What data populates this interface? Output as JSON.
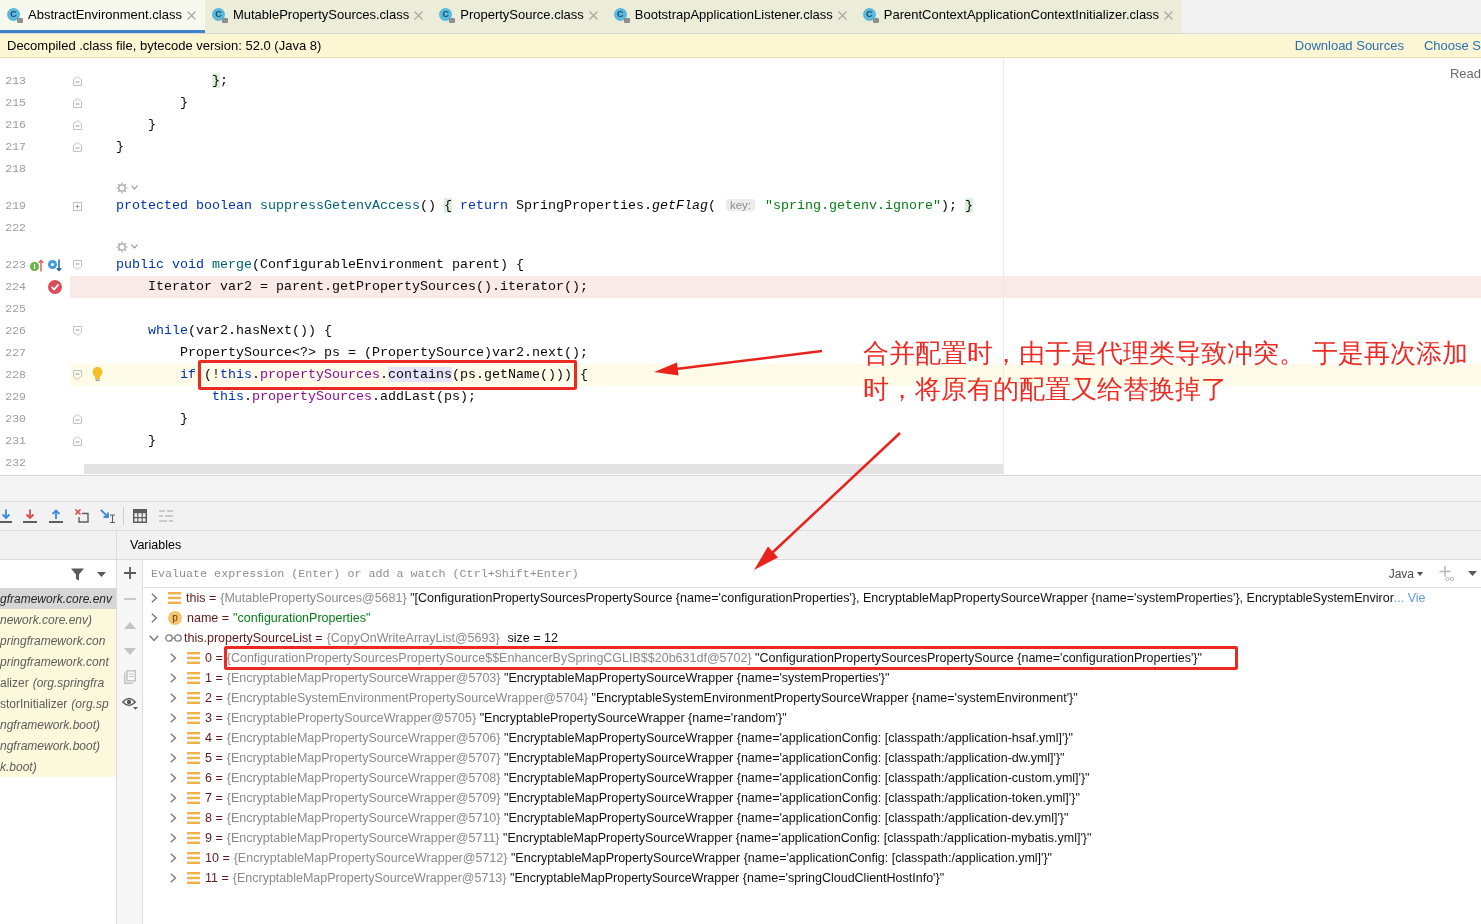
{
  "tabs": [
    {
      "label": "AbstractEnvironment.class",
      "icon_letter": "C",
      "selected": true
    },
    {
      "label": "MutablePropertySources.class",
      "icon_letter": "C",
      "selected": false
    },
    {
      "label": "PropertySource.class",
      "icon_letter": "C",
      "selected": false
    },
    {
      "label": "BootstrapApplicationListener.class",
      "icon_letter": "C",
      "selected": false
    },
    {
      "label": "ParentContextApplicationContextInitializer.class",
      "icon_letter": "C",
      "selected": false
    }
  ],
  "info_bar": {
    "message": "Decompiled .class file, bytecode version: 52.0 (Java 8)",
    "links": [
      "Download Sources",
      "Choose S"
    ]
  },
  "editor": {
    "reader_mode": "Read",
    "lines": [
      {
        "kind": "code",
        "number": "213",
        "fold": {
          "kind": "end"
        },
        "tokens": [
          {
            "kind": "brace",
            "text": "                }"
          },
          {
            "kind": "plain",
            "text": ";"
          }
        ]
      },
      {
        "kind": "code",
        "number": "215",
        "fold": {
          "kind": "end"
        },
        "tokens": [
          {
            "kind": "plain",
            "text": "            }"
          }
        ]
      },
      {
        "kind": "code",
        "number": "216",
        "fold": {
          "kind": "end"
        },
        "tokens": [
          {
            "kind": "plain",
            "text": "        }"
          }
        ]
      },
      {
        "kind": "code",
        "number": "217",
        "fold": {
          "kind": "end"
        },
        "tokens": [
          {
            "kind": "plain",
            "text": "    }"
          }
        ]
      },
      {
        "kind": "code",
        "number": "218"
      },
      {
        "kind": "inlay"
      },
      {
        "kind": "code",
        "number": "219",
        "fold": {
          "kind": "collapsed"
        },
        "tokens": [
          {
            "kind": "keyword",
            "text": "    protected boolean"
          },
          {
            "kind": "declaration",
            "text": " suppressGetenvAccess"
          },
          {
            "kind": "plain",
            "text": "() "
          },
          {
            "kind": "brace",
            "text": "{"
          },
          {
            "kind": "keyword",
            "text": " return"
          },
          {
            "kind": "plain",
            "text": " SpringProperties."
          },
          {
            "kind": "static",
            "text": "getFlag"
          },
          {
            "kind": "plain",
            "text": "( "
          },
          {
            "kind": "hint",
            "text": "key:"
          },
          {
            "kind": "string",
            "text": " \"spring.getenv.ignore\""
          },
          {
            "kind": "plain",
            "text": "); "
          },
          {
            "kind": "brace",
            "text": "}"
          }
        ]
      },
      {
        "kind": "code",
        "number": "222"
      },
      {
        "kind": "inlay"
      },
      {
        "kind": "code",
        "number": "223",
        "fold": {
          "kind": "start"
        },
        "markers": [
          {
            "kind": "implements"
          },
          {
            "kind": "overridden"
          }
        ],
        "tokens": [
          {
            "kind": "keyword",
            "text": "    public void"
          },
          {
            "kind": "declaration",
            "text": " merge"
          },
          {
            "kind": "plain",
            "text": "(ConfigurableEnvironment parent) {"
          }
        ]
      },
      {
        "kind": "code",
        "number": "224",
        "highlight": {
          "kind": "breakpoint"
        },
        "markers": [
          {
            "kind": "breakpoint"
          }
        ],
        "tokens": [
          {
            "kind": "plain",
            "text": "        Iterator var2 = parent.getPropertySources().iterator();"
          }
        ]
      },
      {
        "kind": "code",
        "number": "225"
      },
      {
        "kind": "code",
        "number": "226",
        "fold": {
          "kind": "start"
        },
        "tokens": [
          {
            "kind": "keyword",
            "text": "        while"
          },
          {
            "kind": "plain",
            "text": "(var2.hasNext()) {"
          }
        ]
      },
      {
        "kind": "code",
        "number": "227",
        "tokens": [
          {
            "kind": "plain",
            "text": "            PropertySource<?> ps = (PropertySource)var2.next();"
          }
        ]
      },
      {
        "kind": "code",
        "number": "228",
        "fold": {
          "kind": "start"
        },
        "highlight": {
          "kind": "caret"
        },
        "markers": [
          {
            "kind": "bulb"
          }
        ],
        "tokens": [
          {
            "kind": "keyword",
            "text": "            if "
          },
          {
            "kind": "boxed",
            "tokens": [
              {
                "kind": "plain",
                "text": "(!"
              },
              {
                "kind": "keyword",
                "text": "this"
              },
              {
                "kind": "plain",
                "text": "."
              },
              {
                "kind": "field",
                "text": "propertySources"
              },
              {
                "kind": "plain",
                "text": "."
              },
              {
                "kind": "match",
                "text": "contains"
              },
              {
                "kind": "plain",
                "text": "(ps.getName()))"
              }
            ]
          },
          {
            "kind": "plain",
            "text": " {"
          }
        ]
      },
      {
        "kind": "code",
        "number": "229",
        "tokens": [
          {
            "kind": "keyword",
            "text": "                this"
          },
          {
            "kind": "plain",
            "text": "."
          },
          {
            "kind": "field",
            "text": "propertySources"
          },
          {
            "kind": "plain",
            "text": ".addLast(ps);"
          }
        ]
      },
      {
        "kind": "code",
        "number": "230",
        "fold": {
          "kind": "end"
        },
        "tokens": [
          {
            "kind": "plain",
            "text": "            }"
          }
        ]
      },
      {
        "kind": "code",
        "number": "231",
        "fold": {
          "kind": "end"
        },
        "tokens": [
          {
            "kind": "plain",
            "text": "        }"
          }
        ]
      },
      {
        "kind": "code",
        "number": "232"
      }
    ]
  },
  "annotation": {
    "lines": [
      "合并配置时，由于是代理类导致冲突。 于是再次添加",
      "时，将原有的配置又给替换掉了"
    ]
  },
  "debug": {
    "toolbar": [
      {
        "kind": "step_into",
        "disabled": false
      },
      {
        "kind": "force_step_into",
        "disabled": false
      },
      {
        "kind": "step_out",
        "disabled": false
      },
      {
        "kind": "drop_frame",
        "disabled": false
      },
      {
        "kind": "run_to_cursor",
        "disabled": false
      },
      {
        "kind": "separator"
      },
      {
        "kind": "evaluate",
        "disabled": false
      },
      {
        "kind": "trace",
        "disabled": true
      }
    ],
    "panel_title": "Variables",
    "frames": [
      {
        "location": "gframework.core.env",
        "selected": true
      },
      {
        "location": "nework.core.env)",
        "selected": false
      },
      {
        "location": "pringframework.con",
        "selected": false
      },
      {
        "location": "pringframework.cont",
        "selected": false
      },
      {
        "method": "alizer",
        "location": "(org.springfra",
        "selected": false
      },
      {
        "method": "storInitializer",
        "location": "(org.sp",
        "selected": false
      },
      {
        "location": "ngframework.boot)",
        "selected": false
      },
      {
        "location": "ngframework.boot)",
        "selected": false
      },
      {
        "location": "k.boot)",
        "selected": false
      }
    ],
    "side_toolbar": [
      {
        "kind": "add",
        "disabled": false
      },
      {
        "kind": "remove",
        "disabled": true
      },
      {
        "kind": "move_up",
        "disabled": true
      },
      {
        "kind": "move_down",
        "disabled": true
      },
      {
        "kind": "copy",
        "disabled": true
      },
      {
        "kind": "watches",
        "disabled": false
      }
    ],
    "evaluate": {
      "placeholder": "Evaluate expression (Enter) or add a watch (Ctrl+Shift+Enter)"
    },
    "language": "Java",
    "variables": [
      {
        "kind": "field",
        "label": "this =",
        "type": "{MutablePropertySources@5681}",
        "value": "\"[ConfigurationPropertySourcesPropertySource {name='configurationProperties'}, EncryptableMapPropertySourceWrapper {name='systemProperties'}, EncryptableSystemEnviror",
        "link": "... Vie",
        "expanded": false
      },
      {
        "kind": "parameter",
        "badge": "p",
        "label": "name =",
        "value": "\"configurationProperties\"",
        "expanded": false
      },
      {
        "kind": "watch",
        "label": "this.propertySourceList =",
        "type": "{CopyOnWriteArrayList@5693}",
        "size": "size = 12",
        "expanded": true,
        "children": [
          {
            "kind": "element",
            "label": "0 =",
            "type": "{ConfigurationPropertySourcesPropertySource$$EnhancerBySpringCGLIB$$20b631df@5702}",
            "value": "\"ConfigurationPropertySourcesPropertySource {name='configurationProperties'}\"",
            "expanded": false,
            "annotated": true
          },
          {
            "kind": "element",
            "label": "1 =",
            "type": "{EncryptableMapPropertySourceWrapper@5703}",
            "value": "\"EncryptableMapPropertySourceWrapper {name='systemProperties'}\"",
            "expanded": false,
            "annotated": false
          },
          {
            "kind": "element",
            "label": "2 =",
            "type": "{EncryptableSystemEnvironmentPropertySourceWrapper@5704}",
            "value": "\"EncryptableSystemEnvironmentPropertySourceWrapper {name='systemEnvironment'}\"",
            "expanded": false,
            "annotated": false
          },
          {
            "kind": "element",
            "label": "3 =",
            "type": "{EncryptablePropertySourceWrapper@5705}",
            "value": "\"EncryptablePropertySourceWrapper {name='random'}\"",
            "expanded": false,
            "annotated": false
          },
          {
            "kind": "element",
            "label": "4 =",
            "type": "{EncryptableMapPropertySourceWrapper@5706}",
            "value": "\"EncryptableMapPropertySourceWrapper {name='applicationConfig: [classpath:/application-hsaf.yml]'}\"",
            "expanded": false,
            "annotated": false
          },
          {
            "kind": "element",
            "label": "5 =",
            "type": "{EncryptableMapPropertySourceWrapper@5707}",
            "value": "\"EncryptableMapPropertySourceWrapper {name='applicationConfig: [classpath:/application-dw.yml]'}\"",
            "expanded": false,
            "annotated": false
          },
          {
            "kind": "element",
            "label": "6 =",
            "type": "{EncryptableMapPropertySourceWrapper@5708}",
            "value": "\"EncryptableMapPropertySourceWrapper {name='applicationConfig: [classpath:/application-custom.yml]'}\"",
            "expanded": false,
            "annotated": false
          },
          {
            "kind": "element",
            "label": "7 =",
            "type": "{EncryptableMapPropertySourceWrapper@5709}",
            "value": "\"EncryptableMapPropertySourceWrapper {name='applicationConfig: [classpath:/application-token.yml]'}\"",
            "expanded": false,
            "annotated": false
          },
          {
            "kind": "element",
            "label": "8 =",
            "type": "{EncryptableMapPropertySourceWrapper@5710}",
            "value": "\"EncryptableMapPropertySourceWrapper {name='applicationConfig: [classpath:/application-dev.yml]'}\"",
            "expanded": false,
            "annotated": false
          },
          {
            "kind": "element",
            "label": "9 =",
            "type": "{EncryptableMapPropertySourceWrapper@5711}",
            "value": "\"EncryptableMapPropertySourceWrapper {name='applicationConfig: [classpath:/application-mybatis.yml]'}\"",
            "expanded": false,
            "annotated": false
          },
          {
            "kind": "element",
            "label": "10 =",
            "type": "{EncryptableMapPropertySourceWrapper@5712}",
            "value": "\"EncryptableMapPropertySourceWrapper {name='applicationConfig: [classpath:/application.yml]'}\"",
            "expanded": false,
            "annotated": false
          },
          {
            "kind": "element",
            "label": "11 =",
            "type": "{EncryptableMapPropertySourceWrapper@5713}",
            "value": "\"EncryptableMapPropertySourceWrapper {name='springCloudClientHostInfo'}\"",
            "expanded": false,
            "annotated": false
          }
        ]
      }
    ]
  }
}
